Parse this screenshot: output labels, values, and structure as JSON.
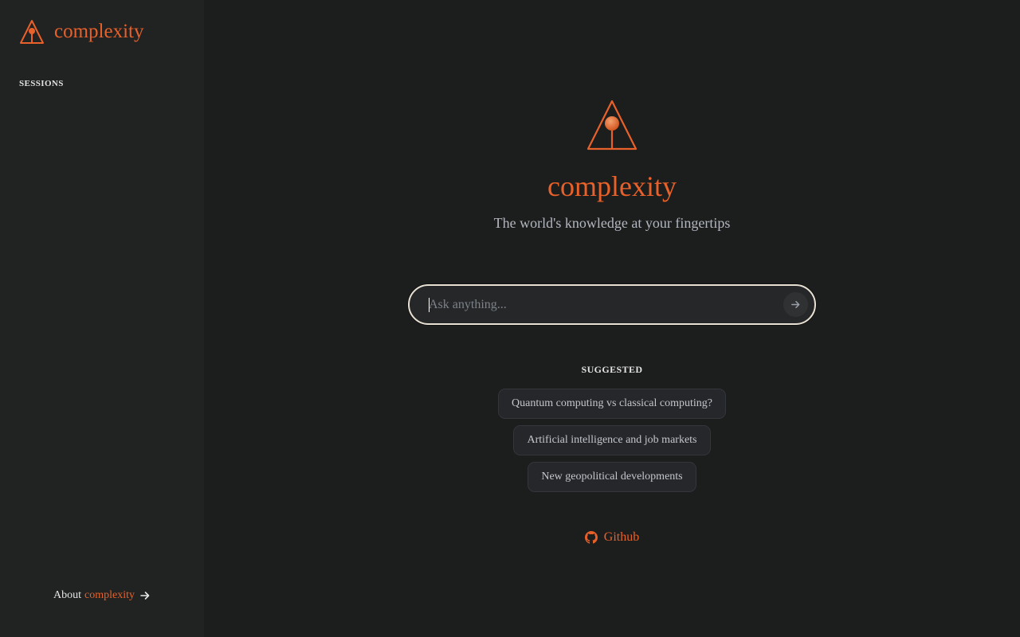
{
  "app": {
    "brand": "complexity",
    "accent_color": "#e8612a"
  },
  "sidebar": {
    "logo_icon": "complexity-logo-icon",
    "sessions_label": "SESSIONS",
    "sessions": [],
    "about": {
      "prefix": "About",
      "brand": "complexity",
      "icon": "arrow-right-icon"
    }
  },
  "hero": {
    "logo_icon": "complexity-logo-icon",
    "title": "complexity",
    "tagline": "The world's knowledge at your fingertips"
  },
  "search": {
    "placeholder": "Ask anything...",
    "value": "",
    "send_icon": "arrow-right-icon"
  },
  "suggested": {
    "label": "SUGGESTED",
    "items": [
      "Quantum computing vs classical computing?",
      "Artificial intelligence and job markets",
      "New geopolitical developments"
    ]
  },
  "footer": {
    "github_label": "Github",
    "github_icon": "github-icon"
  }
}
